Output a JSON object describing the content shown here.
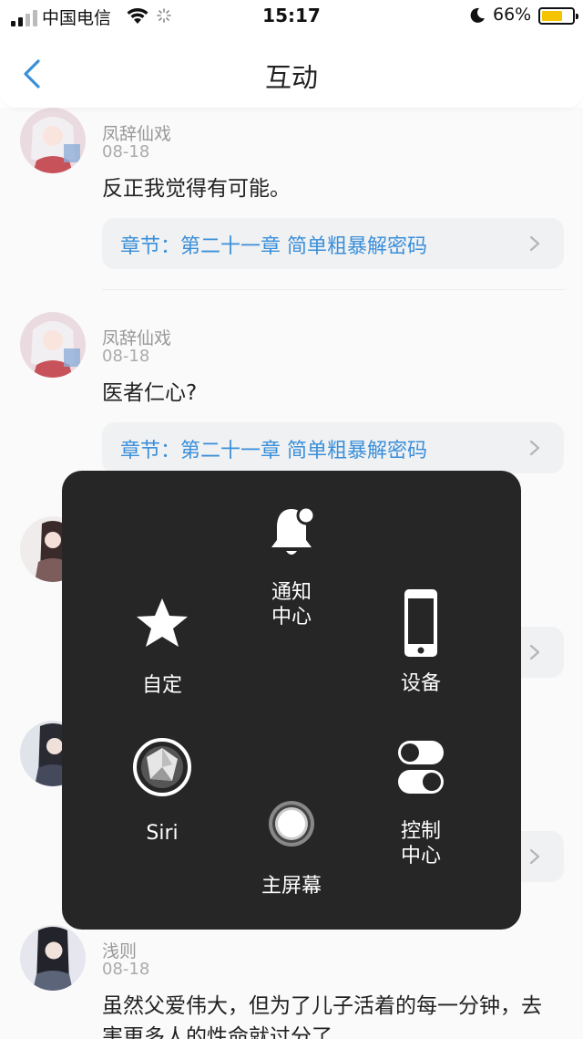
{
  "status_bar": {
    "carrier": "中国电信",
    "time": "15:17",
    "battery_percent": "66%",
    "battery_level": 0.66,
    "battery_color": "#f5c400"
  },
  "nav": {
    "title": "互动",
    "back_icon": "chevron-left-icon",
    "accent": "#3a8fd9"
  },
  "feed": [
    {
      "user": "凤辞仙戏",
      "date": "08-18",
      "text": "反正我觉得有可能。",
      "chapter": "章节：第二十一章 简单粗暴解密码"
    },
    {
      "user": "凤辞仙戏",
      "date": "08-18",
      "text": "医者仁心?",
      "chapter": "章节：第二十一章 简单粗暴解密码"
    },
    {
      "user": "浅则",
      "date": "08-18",
      "text": "虽然父爱伟大，但为了儿子活着的每一分钟，去害更多人的性命就过分了"
    }
  ],
  "assistive_touch": {
    "notification_center": "通知中心",
    "notification_line1": "通知",
    "notification_line2": "中心",
    "custom": "自定",
    "device": "设备",
    "siri": "Siri",
    "control_center_line1": "控制",
    "control_center_line2": "中心",
    "home": "主屏幕",
    "icons": [
      "bell-icon",
      "star-icon",
      "phone-icon",
      "siri-icon",
      "toggle-icon",
      "home-button-icon"
    ]
  }
}
